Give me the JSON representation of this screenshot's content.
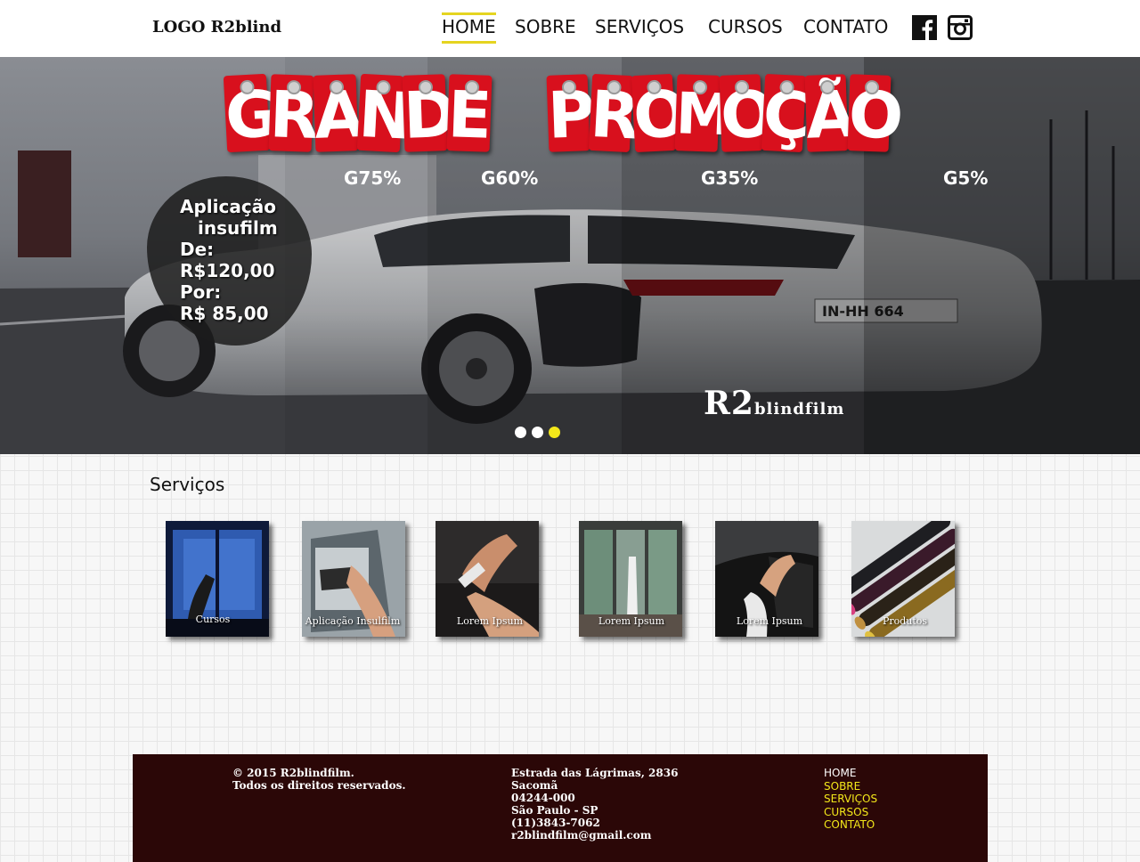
{
  "header": {
    "logo": "LOGO R2blind",
    "nav": [
      {
        "label": "HOME",
        "active": true
      },
      {
        "label": "SOBRE",
        "active": false
      },
      {
        "label": "SERVIÇOS",
        "active": false
      },
      {
        "label": "CURSOS",
        "active": false
      },
      {
        "label": "CONTATO",
        "active": false
      }
    ],
    "social": [
      "facebook-icon",
      "instagram-icon"
    ]
  },
  "hero": {
    "tags_word1": [
      "G",
      "R",
      "A",
      "N",
      "D",
      "E"
    ],
    "tags_word2": [
      "P",
      "R",
      "O",
      "M",
      "O",
      "Ç",
      "Ã",
      "O"
    ],
    "tints": [
      "G75%",
      "G60%",
      "G35%",
      "G5%"
    ],
    "promo": {
      "line1": "Aplicação",
      "line2": "insufilm",
      "line3": "De:",
      "line4": "R$120,00",
      "line5": "Por:",
      "line6": "R$ 85,00"
    },
    "plate": "IN-HH 664",
    "brand_big": "R2",
    "brand_small": "blindfilm",
    "slides": 3,
    "active_slide": 3,
    "colors": {
      "tag": "#d8101d",
      "dot_active": "#f3e71a"
    }
  },
  "services": {
    "title": "Serviços",
    "cards": [
      {
        "caption": "Cursos",
        "image": "window-film-install-image"
      },
      {
        "caption": "Aplicação Insulfilm",
        "image": "car-door-tint-image"
      },
      {
        "caption": "Lorem Ipsum",
        "image": "squeegee-hand-image"
      },
      {
        "caption": "Lorem Ipsum",
        "image": "building-window-image"
      },
      {
        "caption": "Lorem Ipsum",
        "image": "car-interior-tint-image"
      },
      {
        "caption": "Produtos",
        "image": "film-rolls-image"
      }
    ]
  },
  "footer": {
    "copyright1": "© 2015 R2blindfilm.",
    "copyright2": "Todos os direitos reservados.",
    "address": {
      "street": "Estrada das Lágrimas, 2836",
      "district": "Sacomã",
      "zip": "04244-000",
      "city": "São Paulo - SP",
      "phone": "(11)3843-7062",
      "email": "r2blindfilm@gmail.com"
    },
    "links": [
      "HOME",
      "SOBRE",
      "SERVIÇOS",
      "CURSOS",
      "CONTATO"
    ],
    "colors": {
      "background": "#2b0707",
      "link": "#f3e71a"
    }
  }
}
